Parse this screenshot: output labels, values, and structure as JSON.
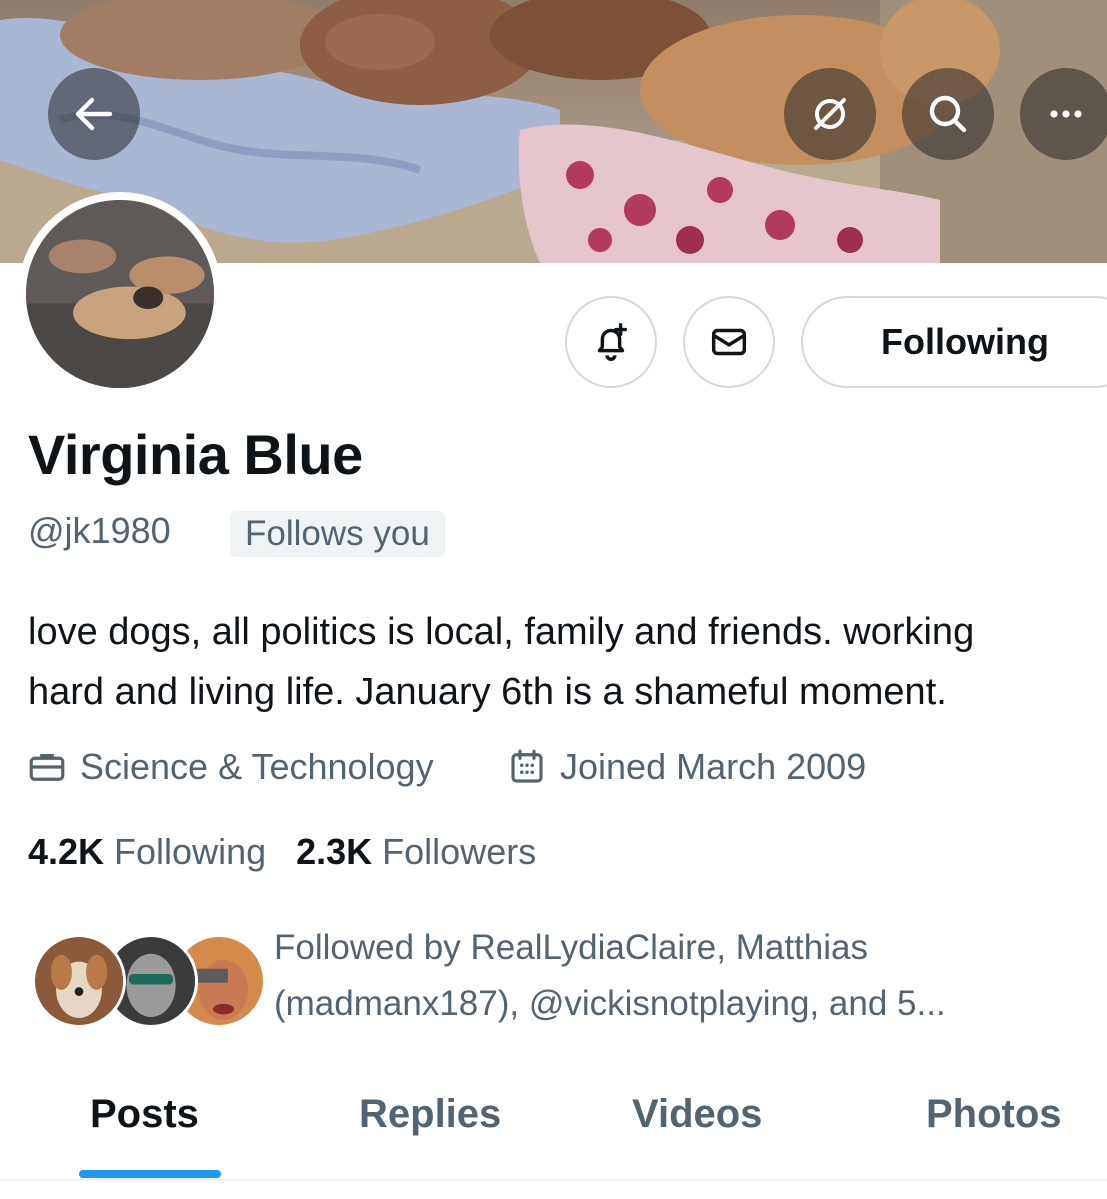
{
  "banner": {
    "back_icon": "arrow-left-icon",
    "translate_icon": "translate-icon",
    "search_icon": "search-icon",
    "more_icon": "more-horizontal-icon"
  },
  "actions": {
    "notify_icon": "bell-plus-icon",
    "message_icon": "envelope-icon",
    "following_label": "Following"
  },
  "profile": {
    "display_name": "Virginia Blue",
    "handle": "@jk1980",
    "follows_you": "Follows you",
    "bio": "love dogs, all politics is local, family and friends. working\nhard and living life. January 6th is a shameful moment.",
    "category": "Science & Technology",
    "joined": "Joined March 2009",
    "following_count": "4.2K",
    "following_label": "Following",
    "followers_count": "2.3K",
    "followers_label": "Followers",
    "followed_by": "Followed by RealLydiaClaire, Matthias (madmanx187), @vickisnotplaying, and 5..."
  },
  "tabs": [
    {
      "label": "Posts",
      "active": true
    },
    {
      "label": "Replies",
      "active": false
    },
    {
      "label": "Videos",
      "active": false
    },
    {
      "label": "Photos",
      "active": false
    }
  ],
  "colors": {
    "accent": "#1d9bf0",
    "text_primary": "#0f1419",
    "text_secondary": "#536471",
    "border": "#cfd9de"
  }
}
